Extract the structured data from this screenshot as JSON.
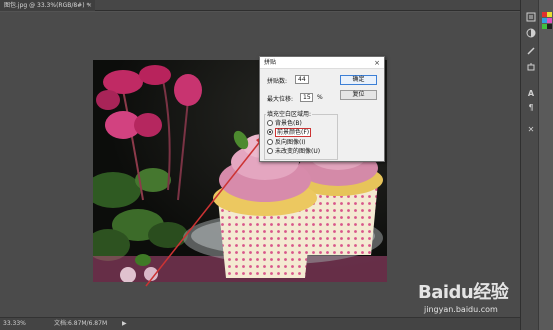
{
  "document": {
    "tab_title": "图包.jpg @ 33.3%(RGB/8#) *",
    "tab_close": "×"
  },
  "status": {
    "zoom": "33.33%",
    "doc_info": "文档:6.87M/6.87M",
    "arrow": "▶"
  },
  "dialog": {
    "title": "拼贴",
    "close": "×",
    "tiles_label": "拼贴数:",
    "tiles_value": "44",
    "max_offset_label": "最大位移:",
    "max_offset_value": "15",
    "max_offset_unit": "%",
    "ok_label": "确定",
    "reset_label": "复位",
    "fill_group_label": "填充空白区域用:",
    "options": [
      {
        "label": "背景色(B)",
        "selected": false
      },
      {
        "label": "前景颜色(F)",
        "selected": true
      },
      {
        "label": "反向图像(I)",
        "selected": false
      },
      {
        "label": "未改变的图像(U)",
        "selected": false
      }
    ]
  },
  "watermark": {
    "logo": "Baidu经验",
    "url": "jingyan.baidu.com"
  },
  "icons": [
    "history-icon",
    "adjust-icon",
    "brush-settings-icon",
    "clone-source-icon",
    "character-icon",
    "paragraph-icon",
    "tools-icon"
  ],
  "colors": {
    "accent": "#cc3333",
    "app_bg": "#535353"
  }
}
